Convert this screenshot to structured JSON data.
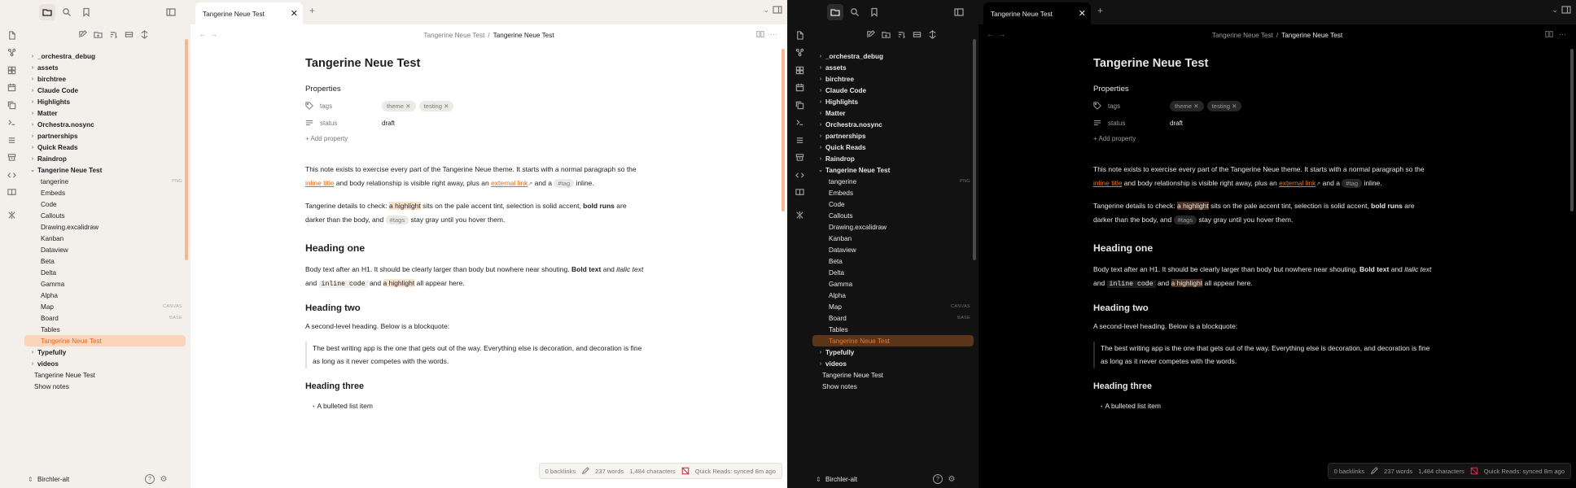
{
  "file_tree": [
    {
      "label": "_orchestra_debug",
      "kind": "folder",
      "chev": "›"
    },
    {
      "label": "assets",
      "kind": "folder",
      "chev": "›"
    },
    {
      "label": "birchtree",
      "kind": "folder",
      "chev": "›"
    },
    {
      "label": "Claude Code",
      "kind": "folder",
      "chev": "›"
    },
    {
      "label": "Highlights",
      "kind": "folder",
      "chev": "›"
    },
    {
      "label": "Matter",
      "kind": "folder",
      "chev": "›"
    },
    {
      "label": "Orchestra.nosync",
      "kind": "folder",
      "chev": "›"
    },
    {
      "label": "partnerships",
      "kind": "folder",
      "chev": "›"
    },
    {
      "label": "Quick Reads",
      "kind": "folder",
      "chev": "›"
    },
    {
      "label": "Raindrop",
      "kind": "folder",
      "chev": "›"
    },
    {
      "label": "Tangerine Neue Test",
      "kind": "folder",
      "chev": "⌄"
    },
    {
      "label": "tangerine",
      "kind": "file",
      "badge": "PNG"
    },
    {
      "label": "Embeds",
      "kind": "file"
    },
    {
      "label": "Code",
      "kind": "file"
    },
    {
      "label": "Callouts",
      "kind": "file"
    },
    {
      "label": "Drawing.excalidraw",
      "kind": "file"
    },
    {
      "label": "Kanban",
      "kind": "file"
    },
    {
      "label": "Dataview",
      "kind": "file"
    },
    {
      "label": "Beta",
      "kind": "file"
    },
    {
      "label": "Delta",
      "kind": "file"
    },
    {
      "label": "Gamma",
      "kind": "file"
    },
    {
      "label": "Alpha",
      "kind": "file"
    },
    {
      "label": "Map",
      "kind": "file",
      "badge": "CANVAS"
    },
    {
      "label": "Board",
      "kind": "file",
      "badge": "BASE"
    },
    {
      "label": "Tables",
      "kind": "file"
    },
    {
      "label": "Tangerine Neue Test",
      "kind": "file",
      "active": true
    },
    {
      "label": "Typefully",
      "kind": "folder",
      "chev": "›"
    },
    {
      "label": "videos",
      "kind": "folder",
      "chev": "›"
    },
    {
      "label": "Tangerine Neue Test",
      "kind": "root"
    },
    {
      "label": "Show notes",
      "kind": "root"
    }
  ],
  "vault_name": "Birchler-alt",
  "vault_chevron": "⇕",
  "help_glyph": "?",
  "settings_glyph": "⚙",
  "tab_title": "Tangerine Neue Test",
  "tab_close": "✕",
  "tab_new": "+",
  "tab_list": "⌄",
  "breadcrumb": {
    "parent": "Tangerine Neue Test",
    "sep": "/",
    "current": "Tangerine Neue Test"
  },
  "nav_back": "←",
  "nav_fwd": "→",
  "nav_more": "⋯",
  "note": {
    "title": "Tangerine Neue Test",
    "properties_heading": "Properties",
    "props": {
      "tags_key": "tags",
      "tag1": "theme",
      "tag2": "testing",
      "remove": "✕",
      "status_key": "status",
      "status_value": "draft"
    },
    "add_property": "+ Add property",
    "p1": {
      "a": "This note exists to exercise every part of the Tangerine Neue theme. It starts with a normal paragraph so the ",
      "link1": "inline title",
      "b": " and body relationship is visible right away, plus an ",
      "link2": "external link",
      "ext": "↗",
      "c": " and a ",
      "tag": "#tag",
      "d": " inline."
    },
    "p2": {
      "a": "Tangerine details to check: ",
      "hl": "a highlight",
      "b": " sits on the pale accent tint, selection is solid accent, ",
      "bold": "bold runs",
      "c": " are darker than the body, and ",
      "tag": "#tags",
      "d": " stay gray until you hover them."
    },
    "h1": "Heading one",
    "p3": {
      "a": "Body text after an H1. It should be clearly larger than body but nowhere near shouting. ",
      "bold": "Bold text",
      "b": " and ",
      "italic": "italic text",
      "c": " and ",
      "code": "inline code",
      "d": " and ",
      "hl": "a highlight",
      "e": " all appear here."
    },
    "h2": "Heading two",
    "p4": "A second-level heading. Below is a blockquote:",
    "quote": "The best writing app is the one that gets out of the way. Everything else is decoration, and decoration is fine as long as it never competes with the words.",
    "h3": "Heading three",
    "bullet_marker": "•",
    "li1": "A bulleted list item"
  },
  "status_bar": {
    "backlinks": "0 backlinks",
    "words": "237 words",
    "chars": "1,484 characters",
    "sync": "Quick Reads: synced 8m ago"
  },
  "colors": {
    "accent_light": "#e06a1a",
    "accent_dark": "#e2782f",
    "selection_light": "#fbd5bb",
    "selection_dark": "#5b3519"
  }
}
